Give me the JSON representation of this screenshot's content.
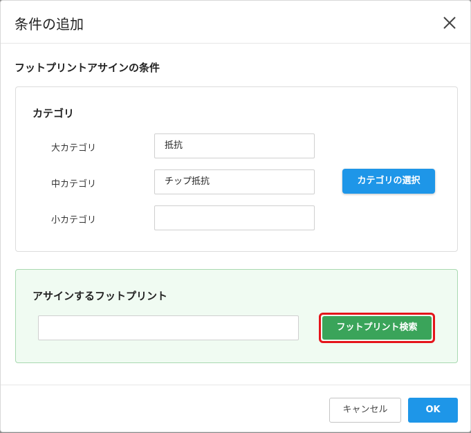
{
  "dialog": {
    "title": "条件の追加",
    "close_icon": "close-icon"
  },
  "assign_conditions": {
    "title": "フットプリントアサインの条件"
  },
  "category": {
    "title": "カテゴリ",
    "large_label": "大カテゴリ",
    "large_value": "抵抗",
    "medium_label": "中カテゴリ",
    "medium_value": "チップ抵抗",
    "small_label": "小カテゴリ",
    "small_value": "",
    "select_button": "カテゴリの選択"
  },
  "footprint": {
    "title": "アサインするフットプリント",
    "value": "",
    "search_button": "フットプリント検索"
  },
  "footer": {
    "cancel_label": "キャンセル",
    "ok_label": "OK"
  },
  "colors": {
    "primary": "#1e96e8",
    "success": "#3aa45a",
    "highlight": "#e5141b"
  }
}
